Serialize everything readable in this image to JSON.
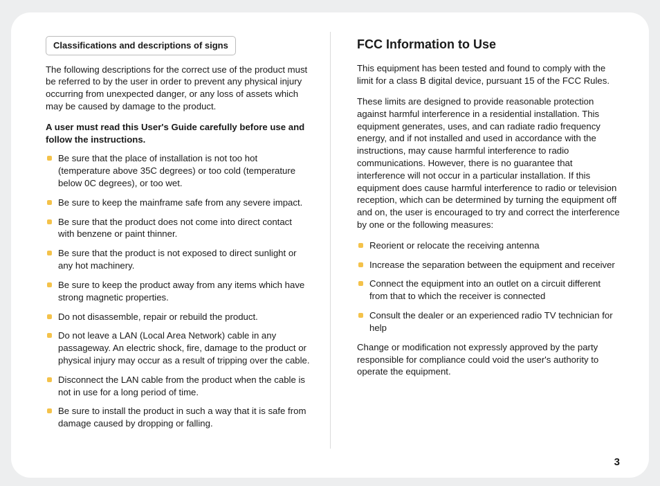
{
  "left": {
    "box_heading": "Classifications and descriptions of signs",
    "intro": "The following descriptions for the correct use of the product must be referred to by the user in order to prevent any physical injury occurring from unexpected danger, or any loss of assets which may be caused by damage to the product.",
    "bold_note": "A user must read this User's Guide carefully before use and follow the instructions.",
    "bullets": [
      "Be sure that the place of installation is not too hot (temperature above 35C degrees) or too cold (temperature below 0C degrees), or too wet.",
      "Be sure to keep the mainframe safe from any severe impact.",
      "Be sure that the product does not come into direct contact with benzene or paint thinner.",
      "Be sure that the product is not exposed to direct sunlight or any hot machinery.",
      "Be sure to keep the product away from any items which have strong magnetic properties.",
      "Do not disassemble, repair or rebuild the product.",
      "Do not leave a LAN (Local Area Network) cable in any passageway. An electric shock, fire, damage to the product or physical injury may occur as a result of tripping over the cable.",
      "Disconnect the LAN cable from the product when the cable is not in use for a long period of time.",
      "Be sure to install the product in such a way that it is safe from damage caused by dropping or falling."
    ]
  },
  "right": {
    "title": "FCC Information to Use",
    "p1": "This equipment has been tested and found to comply with the limit for a class B digital device, pursuant 15 of the FCC Rules.",
    "p2": "These limits are designed to provide reasonable protection against harmful interference in a residential installation. This equipment generates, uses, and can radiate radio frequency energy, and if not installed and used in accordance with the instructions, may cause harmful interference to radio communications. However, there is no guarantee that interference will not occur in a particular installation. If this equipment does cause harmful interference to radio or television reception, which can be determined by turning the equipment off and on, the user is encouraged to try and correct the interference by one or the following measures:",
    "bullets": [
      "Reorient or relocate the receiving antenna",
      "Increase the separation between the equipment and receiver",
      "Connect the equipment into an outlet on a circuit different from that to which the receiver is connected",
      " Consult the dealer or an experienced radio TV technician for help"
    ],
    "p3": "Change or modification not expressly approved by the party responsible for compliance could void the user's authority to operate the equipment."
  },
  "page_number": "3"
}
